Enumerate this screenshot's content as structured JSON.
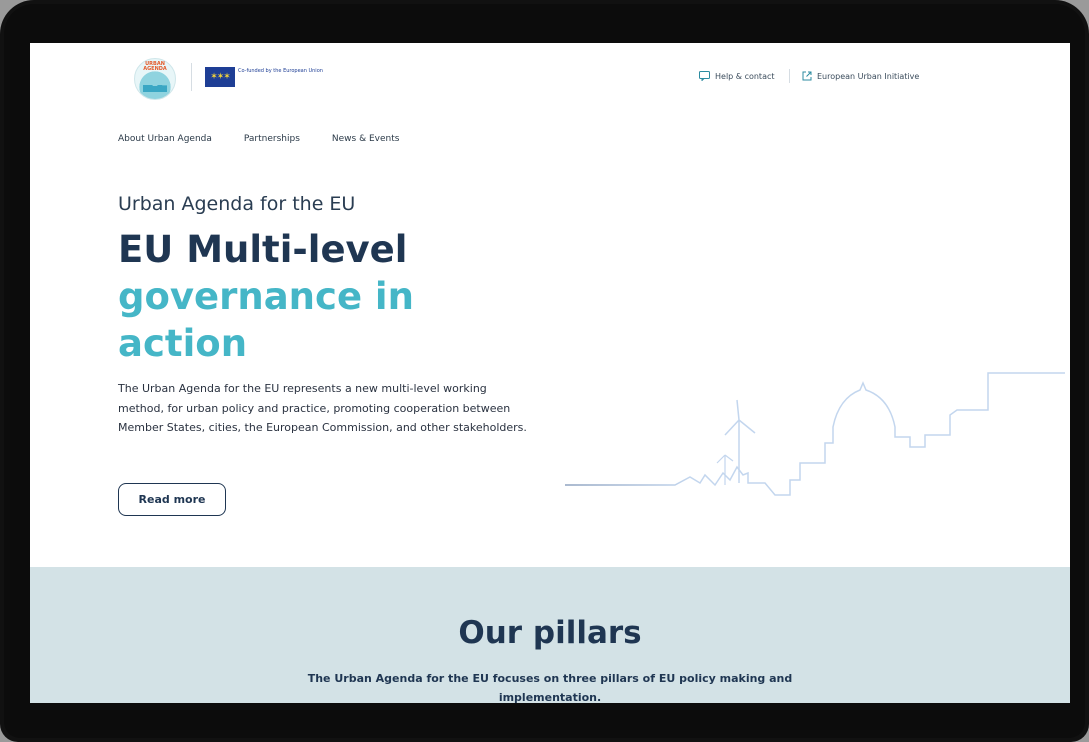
{
  "header": {
    "logo_text": "URBAN AGENDA",
    "eu_caption": "Co-funded by the European Union",
    "help_label": "Help & contact",
    "eui_label": "European Urban Initiative"
  },
  "nav": {
    "items": [
      {
        "label": "About Urban Agenda"
      },
      {
        "label": "Partnerships"
      },
      {
        "label": "News & Events"
      }
    ]
  },
  "hero": {
    "subtitle": "Urban Agenda for the EU",
    "title_line1": "EU Multi-level",
    "title_line2": "governance in action",
    "description": "The Urban Agenda for the EU represents a new multi-level working method, for urban policy and practice, promoting cooperation between Member States, cities, the European Commission, and other stakeholders.",
    "button_label": "Read more"
  },
  "pillars": {
    "title": "Our pillars",
    "description": "The Urban Agenda for the EU focuses on three pillars of EU policy making and implementation."
  },
  "icons": {
    "help": "chat-icon",
    "eui": "external-link-icon",
    "flag": "eu-flag-icon"
  },
  "colors": {
    "navy": "#1f3652",
    "teal": "#45b6c7",
    "pillars_bg": "#d3e2e6",
    "skyline": "#c3d6ee"
  }
}
